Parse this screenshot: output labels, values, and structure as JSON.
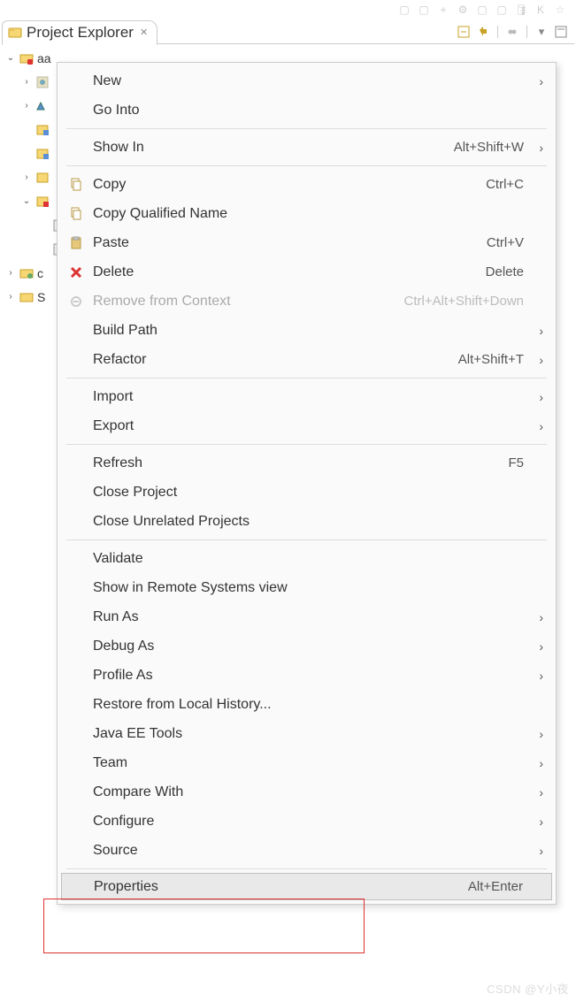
{
  "top_toolbar_icons": [
    "folder",
    "box",
    "plus",
    "gear",
    "box",
    "box",
    "db",
    "K",
    "star"
  ],
  "tab": {
    "title": "Project Explorer",
    "close_glyph": "✕"
  },
  "panel_toolbar_icons": [
    "collapse",
    "link",
    "sep",
    "focus",
    "sep",
    "menu",
    "min"
  ],
  "tree": {
    "root": {
      "label": "aa",
      "expanded": true
    },
    "children_visible": 9
  },
  "menu": {
    "groups": [
      [
        {
          "id": "new",
          "label": "New",
          "submenu": true
        },
        {
          "id": "go-into",
          "label": "Go Into"
        }
      ],
      [
        {
          "id": "show-in",
          "label": "Show In",
          "shortcut": "Alt+Shift+W",
          "submenu": true
        }
      ],
      [
        {
          "id": "copy",
          "icon": "copy",
          "label": "Copy",
          "shortcut": "Ctrl+C"
        },
        {
          "id": "copy-qn",
          "icon": "copy",
          "label": "Copy Qualified Name"
        },
        {
          "id": "paste",
          "icon": "paste",
          "label": "Paste",
          "shortcut": "Ctrl+V"
        },
        {
          "id": "delete",
          "icon": "delete",
          "label": "Delete",
          "shortcut": "Delete"
        },
        {
          "id": "remove-ctx",
          "icon": "remove",
          "label": "Remove from Context",
          "shortcut": "Ctrl+Alt+Shift+Down",
          "disabled": true
        },
        {
          "id": "build-path",
          "label": "Build Path",
          "submenu": true
        },
        {
          "id": "refactor",
          "label": "Refactor",
          "shortcut": "Alt+Shift+T",
          "submenu": true
        }
      ],
      [
        {
          "id": "import",
          "label": "Import",
          "submenu": true
        },
        {
          "id": "export",
          "label": "Export",
          "submenu": true
        }
      ],
      [
        {
          "id": "refresh",
          "label": "Refresh",
          "shortcut": "F5"
        },
        {
          "id": "close-project",
          "label": "Close Project"
        },
        {
          "id": "close-unrelated",
          "label": "Close Unrelated Projects"
        }
      ],
      [
        {
          "id": "validate",
          "label": "Validate"
        },
        {
          "id": "show-rse",
          "label": "Show in Remote Systems view"
        },
        {
          "id": "run-as",
          "label": "Run As",
          "submenu": true
        },
        {
          "id": "debug-as",
          "label": "Debug As",
          "submenu": true
        },
        {
          "id": "profile-as",
          "label": "Profile As",
          "submenu": true
        },
        {
          "id": "restore-local",
          "label": "Restore from Local History..."
        },
        {
          "id": "javaee-tools",
          "label": "Java EE Tools",
          "submenu": true
        },
        {
          "id": "team",
          "label": "Team",
          "submenu": true
        },
        {
          "id": "compare-with",
          "label": "Compare With",
          "submenu": true
        },
        {
          "id": "configure",
          "label": "Configure",
          "submenu": true
        },
        {
          "id": "source",
          "label": "Source",
          "submenu": true
        }
      ],
      [
        {
          "id": "properties",
          "label": "Properties",
          "shortcut": "Alt+Enter",
          "highlighted": true
        }
      ]
    ]
  },
  "watermark": "CSDN @Y小夜"
}
